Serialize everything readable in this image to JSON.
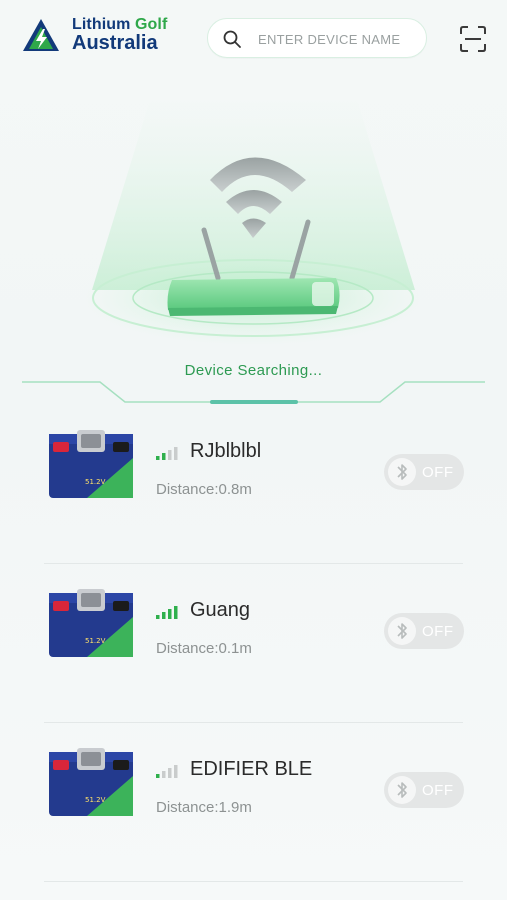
{
  "header": {
    "logo_line1_a": "Lithium",
    "logo_line1_b": "Golf",
    "logo_line2": "Australia",
    "search_placeholder": "ENTER DEVICE NAME",
    "search_value": ""
  },
  "hero": {
    "status_text": "Device Searching..."
  },
  "devices": [
    {
      "name": "RJblblbl",
      "distance": "Distance:0.8m",
      "signal_level": 2,
      "toggle_label": "OFF"
    },
    {
      "name": "Guang",
      "distance": "Distance:0.1m",
      "signal_level": 4,
      "toggle_label": "OFF"
    },
    {
      "name": "EDIFIER BLE",
      "distance": "Distance:1.9m",
      "signal_level": 1,
      "toggle_label": "OFF"
    }
  ],
  "colors": {
    "accent_green": "#2d9a52",
    "brand_blue": "#123a7a",
    "signal_on": "#2fb04d",
    "signal_off": "#c9cccc"
  },
  "icons": [
    "logo-mark-icon",
    "search-icon",
    "scan-icon",
    "wifi-router-icon",
    "signal-icon",
    "bluetooth-icon",
    "battery-image"
  ]
}
